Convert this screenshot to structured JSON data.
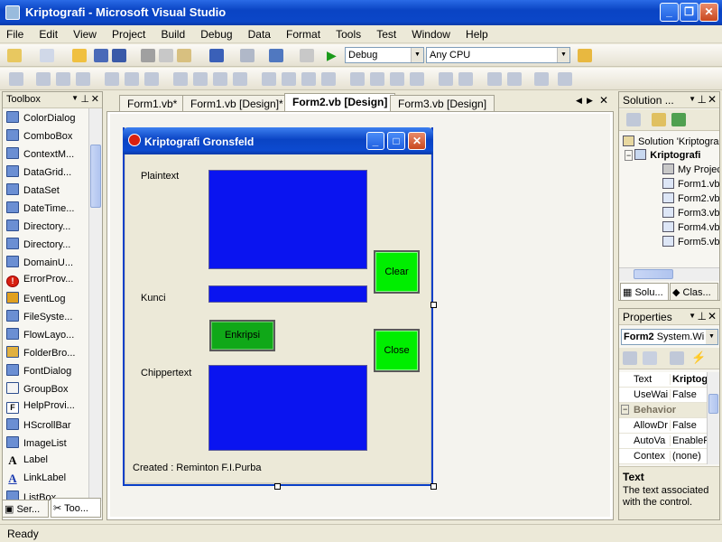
{
  "window": {
    "title": "Kriptografi - Microsoft Visual Studio"
  },
  "menu": [
    "File",
    "Edit",
    "View",
    "Project",
    "Build",
    "Debug",
    "Data",
    "Format",
    "Tools",
    "Test",
    "Window",
    "Help"
  ],
  "toolbar": {
    "config": "Debug",
    "platform": "Any CPU"
  },
  "toolbox": {
    "title": "Toolbox",
    "items": [
      "ColorDialog",
      "ComboBox",
      "ContextM...",
      "DataGrid...",
      "DataSet",
      "DateTime...",
      "Directory...",
      "Directory...",
      "DomainU...",
      "ErrorProv...",
      "EventLog",
      "FileSyste...",
      "FlowLayo...",
      "FolderBro...",
      "FontDialog",
      "GroupBox",
      "HelpProvi...",
      "HScrollBar",
      "ImageList",
      "Label",
      "LinkLabel",
      "ListBox"
    ],
    "bottom_tabs": [
      "Ser...",
      "Too..."
    ]
  },
  "tabs": [
    "Form1.vb*",
    "Form1.vb [Design]*",
    "Form2.vb [Design]",
    "Form3.vb [Design]"
  ],
  "form": {
    "title": "Kriptografi Gronsfeld",
    "plaintext_label": "Plaintext",
    "kunci_label": "Kunci",
    "chipper_label": "Chippertext",
    "clear_button": "Clear",
    "enkripsi_button": "Enkripsi",
    "close_button": "Close",
    "created": "Created : Reminton F.I.Purba"
  },
  "solution": {
    "title": "Solution ...",
    "items": [
      "Solution 'Kriptogra",
      "Kriptografi",
      "My Projec",
      "Form1.vb",
      "Form2.vb",
      "Form3.vb",
      "Form4.vb",
      "Form5.vb"
    ],
    "bottom_tabs": [
      "Solu...",
      "Clas..."
    ]
  },
  "properties": {
    "title": "Properties",
    "object": "Form2",
    "object_type": "System.Wi",
    "rows": [
      {
        "k": "Text",
        "v": "Kriptog"
      },
      {
        "k": "UseWai",
        "v": "False"
      },
      {
        "k": "Behavior",
        "v": ""
      },
      {
        "k": "AllowDr",
        "v": "False"
      },
      {
        "k": "AutoVa",
        "v": "EnableP"
      },
      {
        "k": "Contex",
        "v": "(none)"
      }
    ],
    "desc_title": "Text",
    "desc_text": "The text associated with the control."
  },
  "status": "Ready"
}
